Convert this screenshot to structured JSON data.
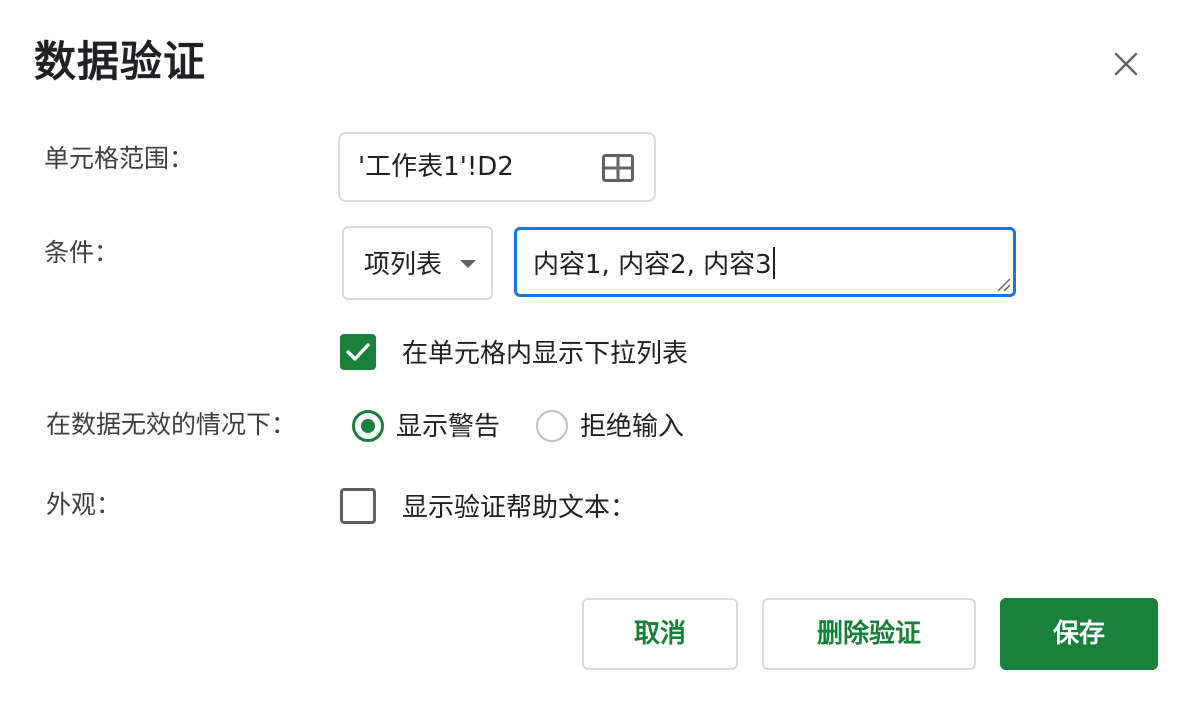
{
  "dialog": {
    "title": "数据验证",
    "close_icon": "close-icon"
  },
  "range": {
    "label": "单元格范围：",
    "value": "'工作表1'!D2",
    "icon": "grid-select-icon"
  },
  "criteria": {
    "label": "条件：",
    "type_selected": "项列表",
    "items_value": "内容1, 内容2, 内容3"
  },
  "dropdown_option": {
    "checked": true,
    "label": "在单元格内显示下拉列表"
  },
  "invalid_data": {
    "label": "在数据无效的情况下：",
    "options": [
      {
        "label": "显示警告",
        "selected": true
      },
      {
        "label": "拒绝输入",
        "selected": false
      }
    ]
  },
  "appearance": {
    "label": "外观：",
    "help_text_checked": false,
    "help_text_label": "显示验证帮助文本："
  },
  "buttons": {
    "cancel": "取消",
    "remove": "删除验证",
    "save": "保存"
  },
  "colors": {
    "accent": "#188038",
    "focus": "#1a73e8",
    "border": "#dadce0"
  }
}
